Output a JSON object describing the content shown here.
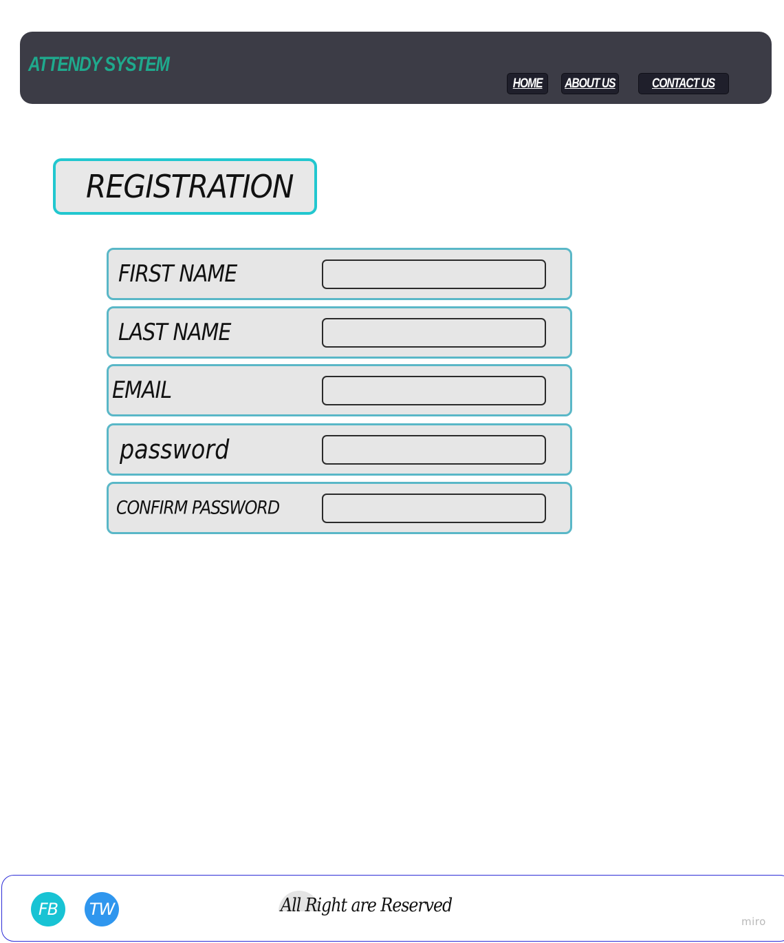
{
  "header": {
    "brand": "ATTENDY SYSTEM",
    "nav": {
      "home": "HOME",
      "about": "ABOUT US",
      "contact": "CONTACT US"
    }
  },
  "registration": {
    "title": "REGISTRATION",
    "fields": [
      {
        "label": "FIRST NAME",
        "value": ""
      },
      {
        "label": "LAST NAME",
        "value": ""
      },
      {
        "label": "EMAIL",
        "value": ""
      },
      {
        "label": "password",
        "value": ""
      },
      {
        "label": "CONFIRM PASSWORD",
        "value": ""
      }
    ]
  },
  "footer": {
    "social": {
      "fb": "FB",
      "tw": "TW"
    },
    "rights": "All Right are Reserved",
    "watermark": "miro"
  },
  "colors": {
    "header_bg": "#3c3c46",
    "brand": "#1fa98d",
    "title_border": "#22c7cf",
    "row_border": "#59b7c7",
    "fb": "#18c3d4",
    "tw": "#2f96ee"
  }
}
